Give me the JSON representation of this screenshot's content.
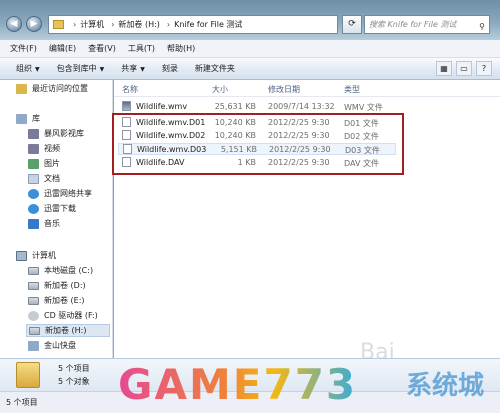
{
  "window": {
    "breadcrumb": [
      "计算机",
      "新加卷 (H:)",
      "Knife for File 测试"
    ],
    "search_placeholder": "搜索 Knife for File 测试"
  },
  "menubar": [
    "文件(F)",
    "编辑(E)",
    "查看(V)",
    "工具(T)",
    "帮助(H)"
  ],
  "toolbar": {
    "organize": "组织",
    "include_library": "包含到库中",
    "share": "共享",
    "burn": "刻录",
    "new_folder": "新建文件夹"
  },
  "navpane": {
    "recent": "最近访问的位置",
    "library": "库",
    "storm": "暴风影视库",
    "videos": "视频",
    "pictures": "图片",
    "documents": "文档",
    "xunlei_share": "迅雷网络共享",
    "xunlei_download": "迅雷下载",
    "music": "音乐",
    "computer": "计算机",
    "drive_c": "本地磁盘 (C:)",
    "drive_d": "新加卷 (D:)",
    "drive_e": "新加卷 (E:)",
    "drive_f": "CD 驱动器 (F:)",
    "drive_h": "新加卷 (H:)",
    "jinshan": "金山快盘"
  },
  "columns": {
    "name": "名称",
    "size": "大小",
    "modified": "修改日期",
    "type": "类型"
  },
  "files": [
    {
      "name": "Wildlife.wmv",
      "size": "25,631 KB",
      "date": "2009/7/14 13:32",
      "type": "WMV 文件"
    },
    {
      "name": "Wildlife.wmv.D01",
      "size": "10,240 KB",
      "date": "2012/2/25 9:30",
      "type": "D01 文件"
    },
    {
      "name": "Wildlife.wmv.D02",
      "size": "10,240 KB",
      "date": "2012/2/25 9:30",
      "type": "D02 文件"
    },
    {
      "name": "Wildlife.wmv.D03",
      "size": "5,151 KB",
      "date": "2012/2/25 9:30",
      "type": "D03 文件"
    },
    {
      "name": "Wildlife.DAV",
      "size": "1 KB",
      "date": "2012/2/25 9:30",
      "type": "DAV 文件"
    }
  ],
  "details": {
    "count": "5 个项目",
    "count2": "5 个对象"
  },
  "statusbar": "5 个项目",
  "watermark": {
    "main": "GAME773",
    "cn": "系统城",
    "baidu": "Bai"
  }
}
